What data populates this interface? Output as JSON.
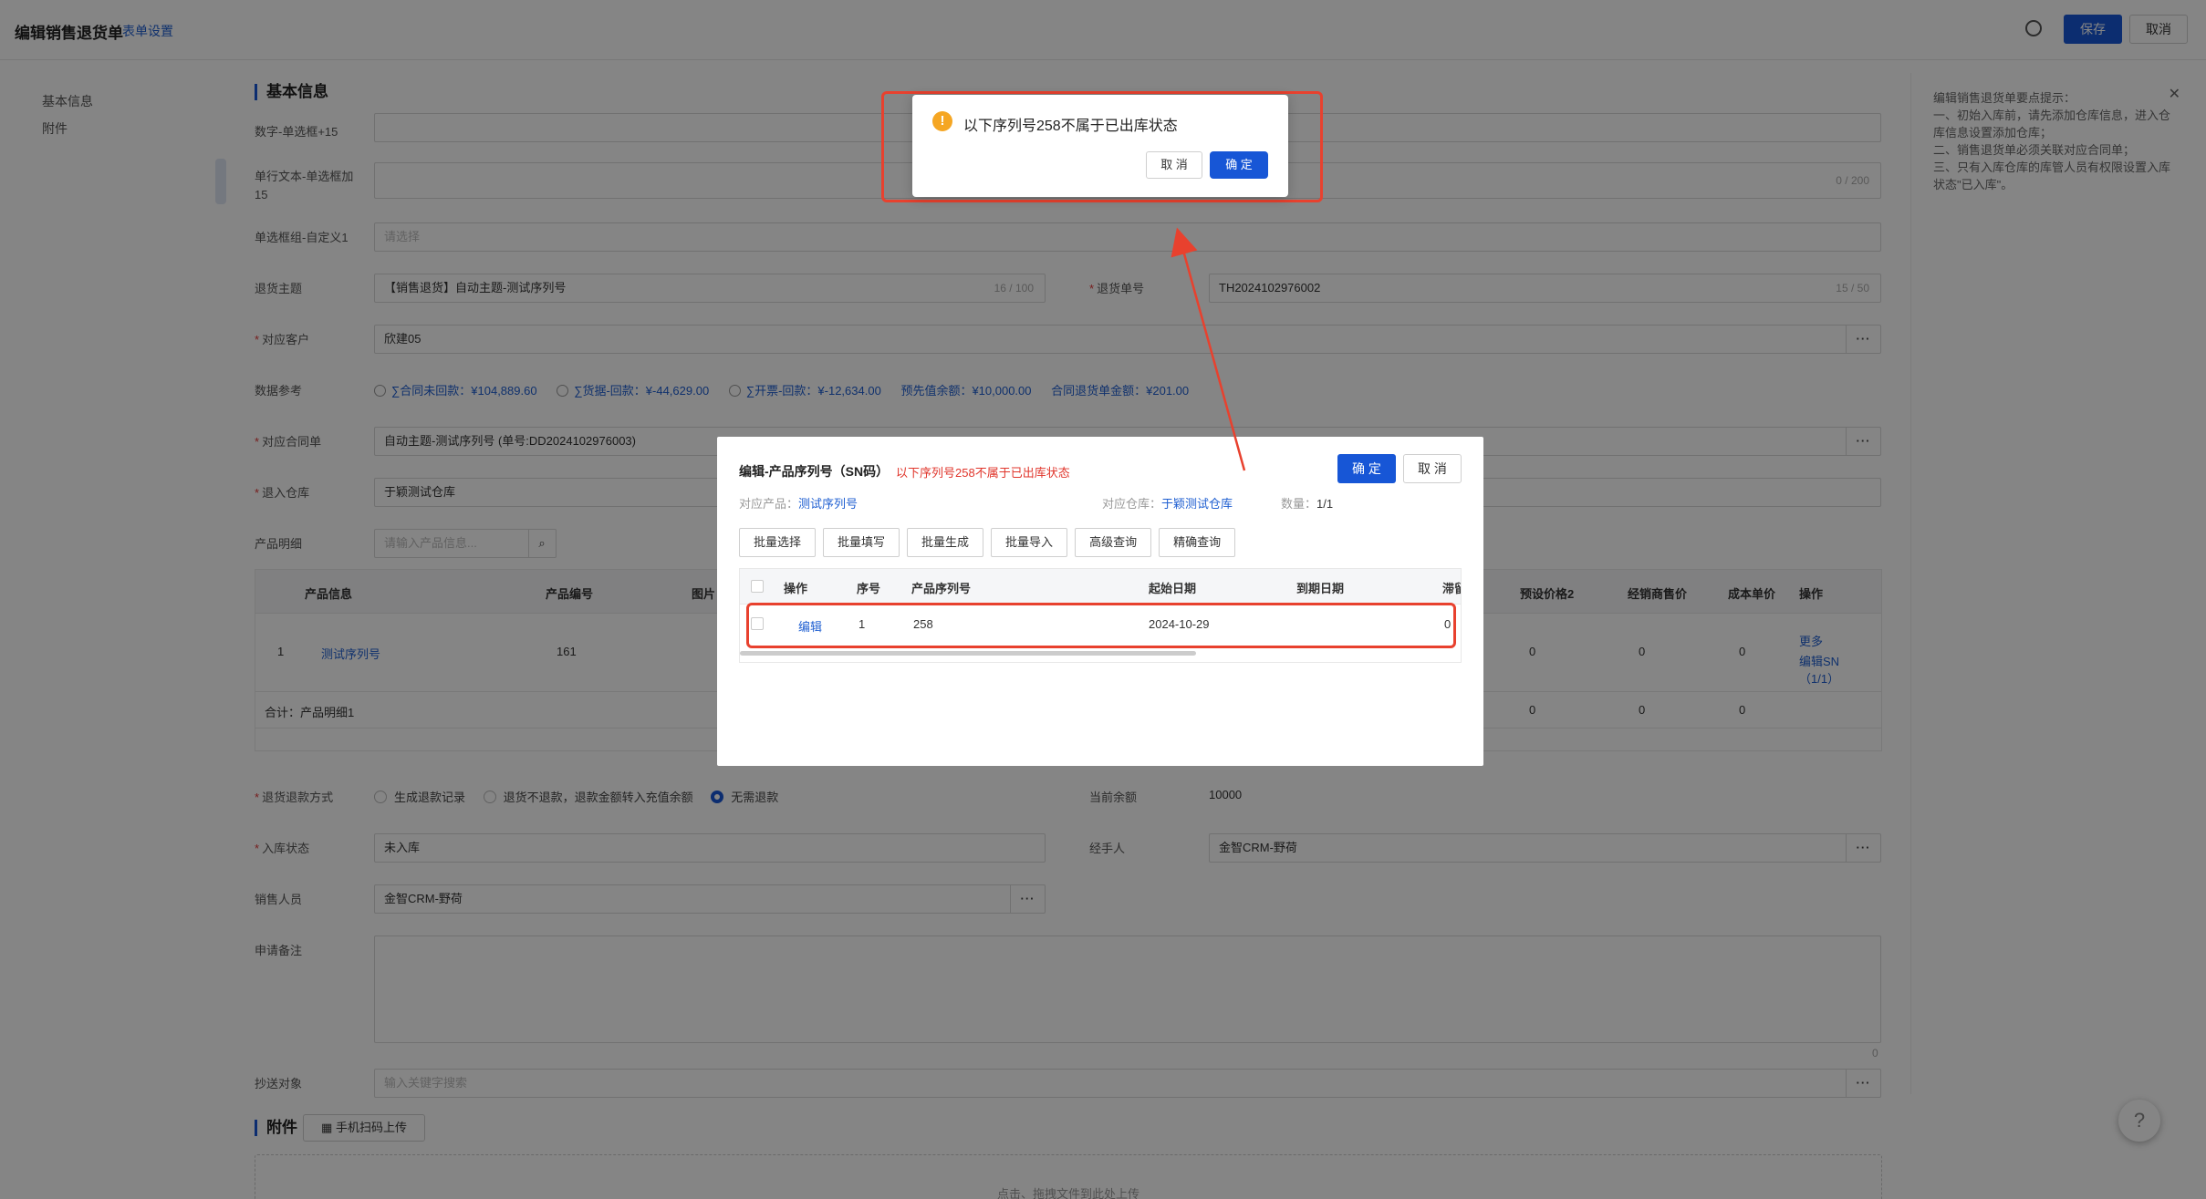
{
  "header": {
    "title": "编辑销售退货单",
    "settings_link": "表单设置",
    "save": "保存",
    "cancel": "取消"
  },
  "nav": {
    "items": [
      "基本信息",
      "附件"
    ]
  },
  "section_basic": "基本信息",
  "section_attach": "附件",
  "mobile_upload": "手机扫码上传",
  "upload_hint": "点击、拖拽文件到此处上传",
  "form": {
    "num_single_label": "数字-单选框+15",
    "single_text_label": "单行文本-单选框加15",
    "single_text_count": "0 / 200",
    "radio_group_label": "单选框组-自定义1",
    "radio_group_placeholder": "请选择",
    "subject_label": "退货主题",
    "subject_value": "【销售退货】自动主题-测试序列号",
    "subject_count": "16 / 100",
    "order_no_label": "退货单号",
    "order_no_value": "TH2024102976002",
    "order_no_count": "15 / 50",
    "customer_label": "对应客户",
    "customer_value": "欣建05",
    "dataref_label": "数据参考",
    "dataref_items": [
      "∑合同未回款：¥104,889.60",
      "∑货据-回款：¥-44,629.00",
      "∑开票-回款：¥-12,634.00",
      "预先值余额：¥10,000.00",
      "合同退货单金额：¥201.00"
    ],
    "contract_label": "对应合同单",
    "contract_value": "自动主题-测试序列号 (单号:DD2024102976003)",
    "warehouse_label": "退入仓库",
    "warehouse_value": "于颖测试仓库",
    "product_detail_label": "产品明细",
    "product_search_placeholder": "请输入产品信息...",
    "refund_label": "退货退款方式",
    "refund_options": [
      "生成退款记录",
      "退货不退款，退款金额转入充值余额",
      "无需退款"
    ],
    "balance_label": "当前余额",
    "balance_value": "10000",
    "stock_status_label": "入库状态",
    "stock_status_value": "未入库",
    "handler_label": "经手人",
    "handler_value": "金智CRM-野荷",
    "sales_label": "销售人员",
    "sales_value": "金智CRM-野荷",
    "remark_label": "申请备注",
    "remark_count": "0",
    "cc_label": "抄送对象",
    "cc_placeholder": "输入关键字搜索"
  },
  "product_table": {
    "headers": [
      "产品信息",
      "产品编号",
      "图片",
      "预设价格2",
      "经销商售价",
      "成本单价",
      "操作"
    ],
    "row": {
      "index": "1",
      "name": "测试序列号",
      "code": "161",
      "price2": "0",
      "dealer": "0",
      "cost": "0",
      "op_more": "更多",
      "op_sn": "编辑SN（1/1）"
    },
    "total_label": "合计：产品明细1",
    "total_values": [
      "0",
      "0",
      "0"
    ]
  },
  "tips": {
    "title": "编辑销售退货单要点提示：",
    "lines": [
      "一、初始入库前，请先添加仓库信息，进入仓库信息设置添加仓库；",
      "二、销售退货单必须关联对应合同单；",
      "三、只有入库仓库的库管人员有权限设置入库状态\"已入库\"。"
    ]
  },
  "sn_modal": {
    "title": "编辑-产品序列号（SN码）",
    "error": "以下序列号258不属于已出库状态",
    "confirm": "确 定",
    "cancel": "取 消",
    "product_label": "对应产品：",
    "product_value": "测试序列号",
    "warehouse_label": "对应仓库：",
    "warehouse_value": "于颖测试仓库",
    "qty_label": "数量：",
    "qty_value": "1/1",
    "tools": [
      "批量选择",
      "批量填写",
      "批量生成",
      "批量导入",
      "高级查询",
      "精确查询"
    ],
    "headers": [
      "操作",
      "序号",
      "产品序列号",
      "起始日期",
      "到期日期",
      "滞留"
    ],
    "row": {
      "op": "编辑",
      "index": "1",
      "sn": "258",
      "start": "2024-10-29",
      "end": "",
      "stay": "0"
    }
  },
  "confirm_dialog": {
    "message": "以下序列号258不属于已出库状态",
    "cancel": "取 消",
    "ok": "确 定"
  }
}
